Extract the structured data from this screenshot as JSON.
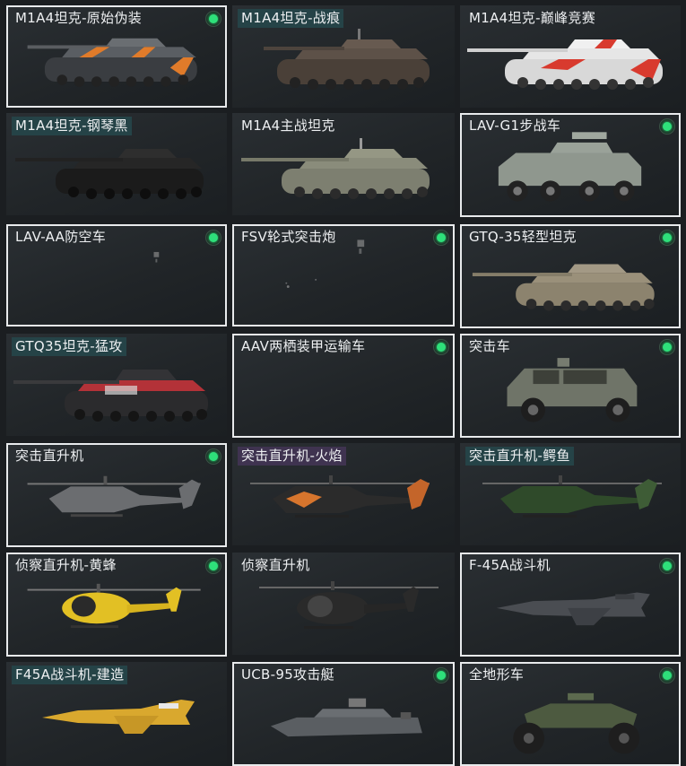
{
  "vehicles": [
    {
      "label": "M1A4坦克-原始伪装",
      "selected": true,
      "badge": true,
      "icon": "tank-icon"
    },
    {
      "label": "M1A4坦克-战痕",
      "selected": false,
      "badge": true,
      "icon": "tank-icon"
    },
    {
      "label": "M1A4坦克-巅峰竞赛",
      "selected": false,
      "badge": false,
      "icon": "tank-icon"
    },
    {
      "label": "M1A4坦克-钢琴黑",
      "selected": false,
      "badge": false,
      "icon": "tank-icon"
    },
    {
      "label": "M1A4主战坦克",
      "selected": false,
      "badge": false,
      "icon": "tank-icon"
    },
    {
      "label": "LAV-G1步战车",
      "selected": true,
      "badge": true,
      "icon": "armored-car-icon"
    },
    {
      "label": "LAV-AA防空车",
      "selected": true,
      "badge": true,
      "icon": "placeholder-icon"
    },
    {
      "label": "FSV轮式突击炮",
      "selected": true,
      "badge": true,
      "icon": "placeholder-icon"
    },
    {
      "label": "GTQ-35轻型坦克",
      "selected": true,
      "badge": true,
      "icon": "tank-icon"
    },
    {
      "label": "GTQ35坦克-猛攻",
      "selected": false,
      "badge": false,
      "icon": "tank-icon"
    },
    {
      "label": "AAV两栖装甲运输车",
      "selected": true,
      "badge": true,
      "icon": "placeholder-icon"
    },
    {
      "label": "突击车",
      "selected": true,
      "badge": true,
      "icon": "armored-car-icon"
    },
    {
      "label": "突击直升机",
      "selected": true,
      "badge": true,
      "icon": "helicopter-icon"
    },
    {
      "label": "突击直升机-火焰",
      "selected": false,
      "badge": false,
      "icon": "helicopter-icon"
    },
    {
      "label": "突击直升机-鳄鱼",
      "selected": false,
      "badge": false,
      "icon": "helicopter-icon"
    },
    {
      "label": "侦察直升机-黄蜂",
      "selected": true,
      "badge": true,
      "icon": "helicopter-icon"
    },
    {
      "label": "侦察直升机",
      "selected": false,
      "badge": false,
      "icon": "helicopter-icon"
    },
    {
      "label": "F-45A战斗机",
      "selected": true,
      "badge": true,
      "icon": "jet-icon"
    },
    {
      "label": "F45A战斗机-建造",
      "selected": false,
      "badge": false,
      "icon": "jet-icon"
    },
    {
      "label": "UCB-95攻击艇",
      "selected": true,
      "badge": true,
      "icon": "boat-icon"
    },
    {
      "label": "全地形车",
      "selected": true,
      "badge": true,
      "icon": "atv-icon"
    }
  ],
  "colors": {
    "badge_on": "#2ee07a",
    "selected_border": "#e8eaec"
  }
}
